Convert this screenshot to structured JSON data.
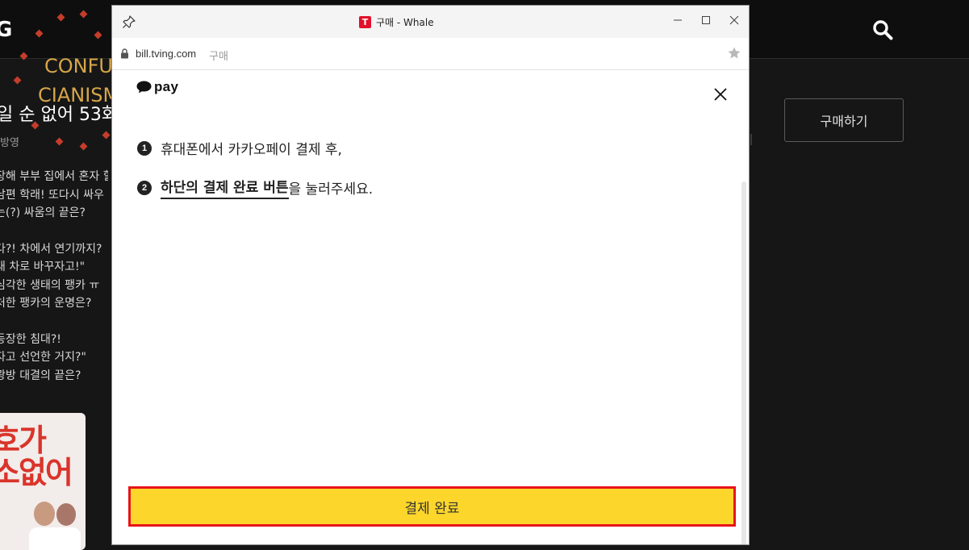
{
  "background": {
    "logo_text": "G",
    "episode_title": "일 순 없어 53화",
    "sub_text": "방영",
    "desc_lines": [
      "장해 부부 집에서 혼자 할",
      "남편 학래! 또다시 싸우",
      "는(?) 싸움의 끝은?",
      "",
      "다?! 차에서 연기까지?",
      "새 차로 바꾸자고!\"",
      "심각한 생태의 팽카 ㅠ",
      "처한 팽카의 운명은?",
      "",
      "등장한 침대?!",
      "자고 선언한 거지?\"",
      "광방 대결의 끝은?"
    ],
    "buy_button": "구매하기",
    "poster_text": [
      "호가",
      "소없어"
    ],
    "watermark": [
      "CONFU",
      "CIANISM"
    ]
  },
  "window": {
    "favicon_letter": "T",
    "title": "구매 - Whale",
    "url_domain": "bill.tving.com",
    "url_path": "구매"
  },
  "kakaopay": {
    "logo_word": "pay",
    "steps": [
      {
        "num": "1",
        "text": "휴대폰에서 카카오페이 결제 후,"
      },
      {
        "num": "2",
        "emphasis": "하단의 결제 완료 버튼",
        "rest": "을 눌러주세요."
      }
    ],
    "complete_button": "결제 완료"
  },
  "colors": {
    "kakao_yellow": "#fcd62b",
    "highlight_red": "#e8141a",
    "tving_red": "#e3102a",
    "background_dark": "#161616"
  },
  "icons": [
    "pin-icon",
    "tving-favicon",
    "minimize-icon",
    "maximize-icon",
    "close-window-icon",
    "lock-icon",
    "star-icon",
    "kakao-bubble-icon",
    "close-icon",
    "search-icon"
  ]
}
